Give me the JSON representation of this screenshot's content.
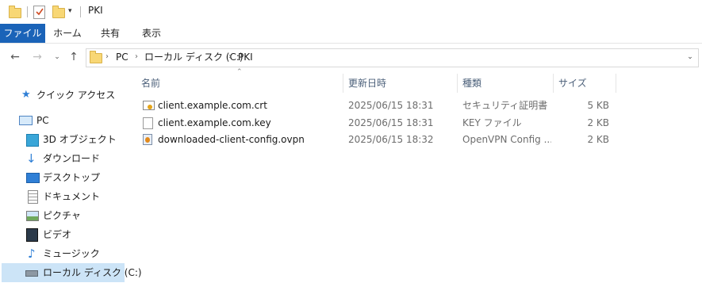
{
  "window": {
    "title": "PKI"
  },
  "ribbon": {
    "tabs": [
      "ファイル",
      "ホーム",
      "共有",
      "表示"
    ]
  },
  "address": {
    "crumbs": [
      "PC",
      "ローカル ディスク (C:)",
      "PKI"
    ]
  },
  "sidebar": {
    "items": [
      {
        "label": "クイック アクセス",
        "icon": "star-icon"
      },
      {
        "label": "PC",
        "icon": "pc-icon"
      },
      {
        "label": "3D オブジェクト",
        "icon": "3d-objects-icon"
      },
      {
        "label": "ダウンロード",
        "icon": "download-arrow-icon"
      },
      {
        "label": "デスクトップ",
        "icon": "desktop-icon"
      },
      {
        "label": "ドキュメント",
        "icon": "document-icon"
      },
      {
        "label": "ピクチャ",
        "icon": "pictures-icon"
      },
      {
        "label": "ビデオ",
        "icon": "video-icon"
      },
      {
        "label": "ミュージック",
        "icon": "music-note-icon"
      },
      {
        "label": "ローカル ディスク (C:)",
        "icon": "drive-icon",
        "selected": true
      }
    ]
  },
  "columns": {
    "name": "名前",
    "date": "更新日時",
    "type": "種類",
    "size": "サイズ"
  },
  "files": [
    {
      "name": "client.example.com.crt",
      "date": "2025/06/15 18:31",
      "type": "セキュリティ証明書",
      "size": "5 KB",
      "icon": "certificate-icon"
    },
    {
      "name": "client.example.com.key",
      "date": "2025/06/15 18:31",
      "type": "KEY ファイル",
      "size": "2 KB",
      "icon": "blank-file-icon"
    },
    {
      "name": "downloaded-client-config.ovpn",
      "date": "2025/06/15 18:32",
      "type": "OpenVPN Config ...",
      "size": "2 KB",
      "icon": "openvpn-config-icon"
    }
  ],
  "colors": {
    "accent": "#1a63b8",
    "selection": "#cce4f7",
    "header_text": "#4c607a"
  }
}
